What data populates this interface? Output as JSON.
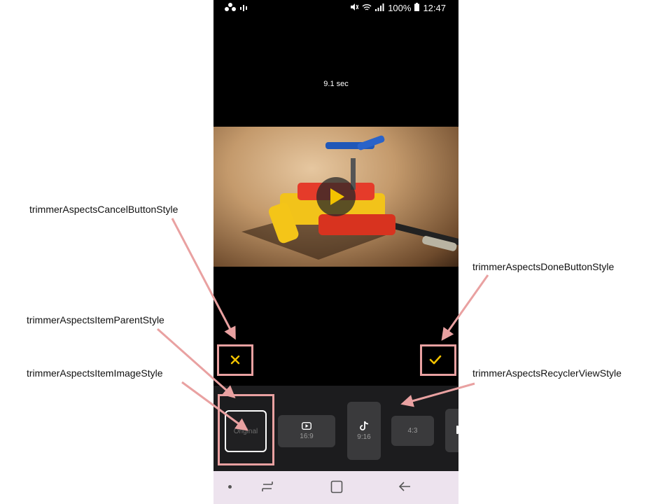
{
  "status": {
    "time": "12:47",
    "battery": "100%"
  },
  "duration": "9.1 sec",
  "aspects": [
    {
      "label": "Original",
      "icon": "none",
      "selected": true
    },
    {
      "label": "16:9",
      "icon": "youtube-icon",
      "selected": false
    },
    {
      "label": "9:16",
      "icon": "tiktok-icon",
      "selected": false
    },
    {
      "label": "4:3",
      "icon": "none",
      "selected": false
    }
  ],
  "callouts": {
    "cancel": "trimmerAspectsCancelButtonStyle",
    "done": "trimmerAspectsDoneButtonStyle",
    "item_parent": "trimmerAspectsItemParentStyle",
    "item_image": "trimmerAspectsItemImageStyle",
    "recycler": "trimmerAspectsRecyclerViewStyle"
  },
  "colors": {
    "accent": "#f2c200",
    "highlight": "#e9a1a1",
    "panel": "#1c1c1e"
  }
}
